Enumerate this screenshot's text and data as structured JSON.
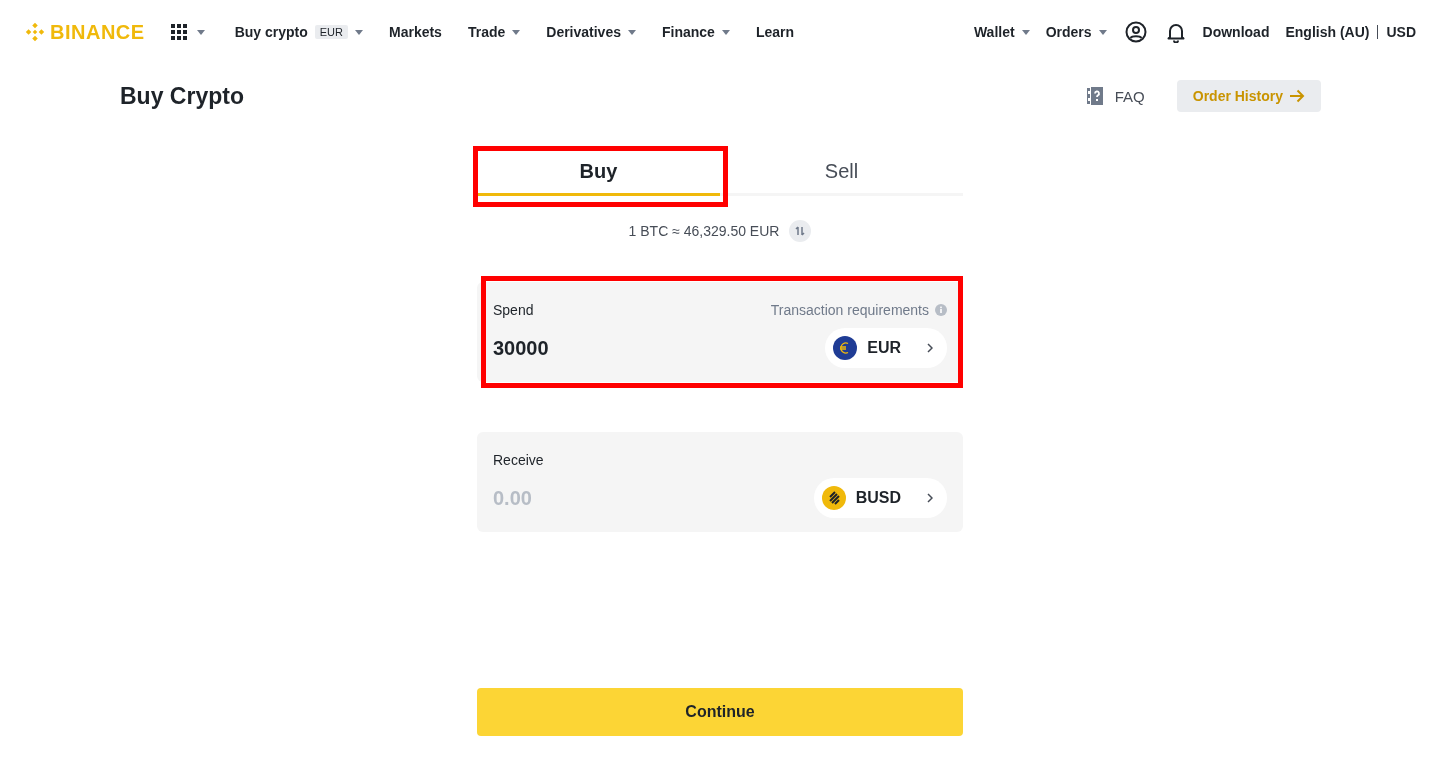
{
  "header": {
    "logo": "BINANCE",
    "nav": [
      {
        "label": "Buy crypto",
        "badge": "EUR",
        "has_menu": true
      },
      {
        "label": "Markets",
        "has_menu": false
      },
      {
        "label": "Trade",
        "has_menu": true
      },
      {
        "label": "Derivatives",
        "has_menu": true
      },
      {
        "label": "Finance",
        "has_menu": true
      },
      {
        "label": "Learn",
        "has_menu": false
      }
    ],
    "right_nav": [
      {
        "label": "Wallet",
        "has_menu": true
      },
      {
        "label": "Orders",
        "has_menu": true
      }
    ],
    "download": "Download",
    "language": "English (AU)",
    "currency": "USD"
  },
  "page": {
    "title": "Buy Crypto",
    "faq": "FAQ",
    "order_history": "Order History"
  },
  "tabs": [
    {
      "label": "Buy",
      "selected": true,
      "highlighted": true
    },
    {
      "label": "Sell",
      "selected": false,
      "highlighted": false
    }
  ],
  "rate": "1 BTC ≈ 46,329.50 EUR",
  "fields": [
    {
      "label": "Spend",
      "hint": "Transaction requirements",
      "value": "30000",
      "currency": "EUR",
      "kind": "euro",
      "highlighted": true
    },
    {
      "label": "Receive",
      "placeholder": "0.00",
      "currency": "BUSD",
      "kind": "busd",
      "highlighted": false
    }
  ],
  "continue": "Continue"
}
